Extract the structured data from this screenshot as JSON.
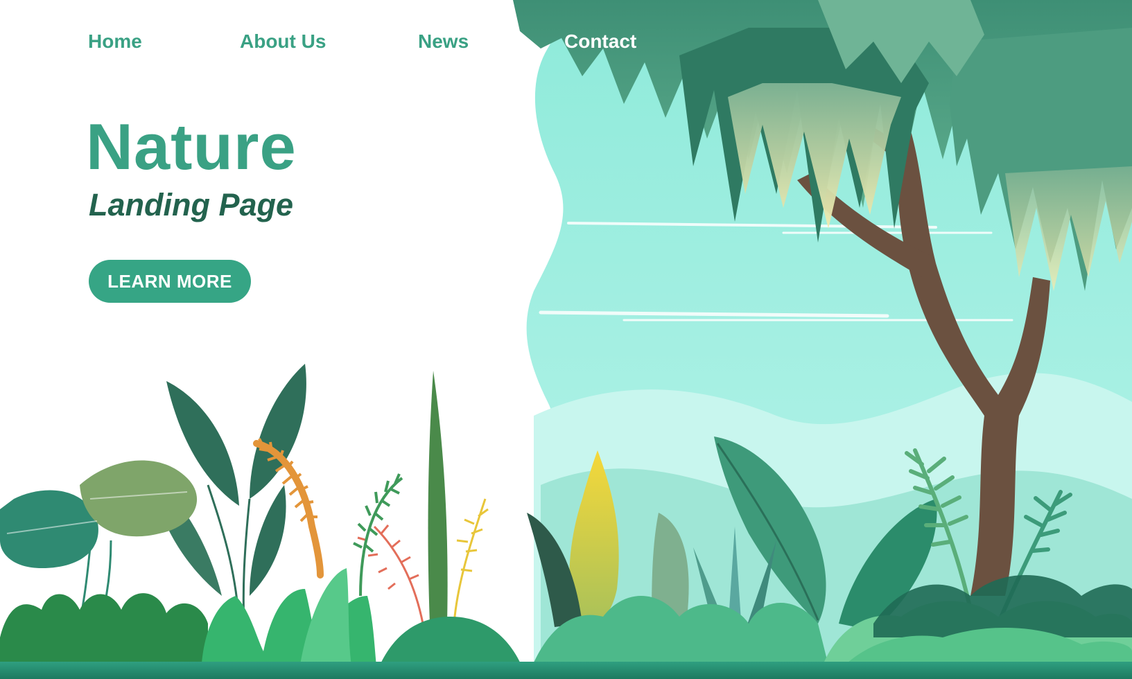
{
  "nav": {
    "items": [
      {
        "label": "Home"
      },
      {
        "label": "About Us"
      },
      {
        "label": "News"
      },
      {
        "label": "Contact"
      }
    ]
  },
  "hero": {
    "title": "Nature",
    "subtitle": "Landing Page",
    "cta_label": "LEARN MORE"
  },
  "colors": {
    "accent": "#3aa184",
    "accent_dark": "#23634e",
    "button": "#36a585",
    "sky": "#a8f0e4",
    "trunk": "#6b5140",
    "canopy": "#3c8a72"
  }
}
